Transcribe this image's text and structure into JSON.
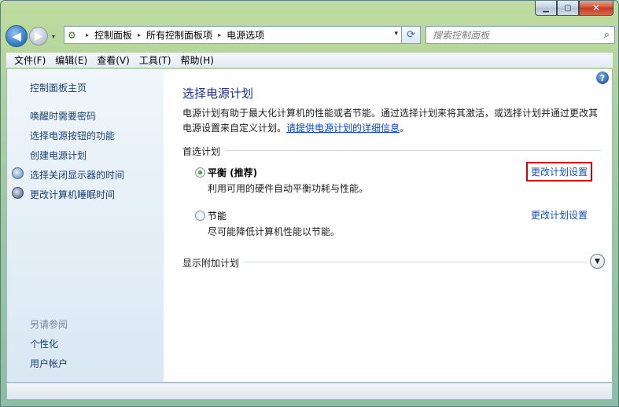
{
  "window": {
    "caption_min": "▁",
    "caption_max": "▢",
    "caption_close": "✕"
  },
  "nav": {
    "back_glyph": "◀",
    "forward_glyph": "▶",
    "dropdown_glyph": "▾"
  },
  "address": {
    "crumbs": [
      "控制面板",
      "所有控制面板项",
      "电源选项"
    ],
    "separator": "▸"
  },
  "search": {
    "placeholder": "搜索控制面板"
  },
  "menubar": {
    "items": [
      "文件(F)",
      "编辑(E)",
      "查看(V)",
      "工具(T)",
      "帮助(H)"
    ]
  },
  "sidebar": {
    "home": "控制面板主页",
    "links": [
      "唤醒时需要密码",
      "选择电源按钮的功能",
      "创建电源计划",
      "选择关闭显示器的时间",
      "更改计算机睡眠时间"
    ],
    "see_also_caption": "另请参阅",
    "see_also": [
      "个性化",
      "用户帐户"
    ]
  },
  "main": {
    "title": "选择电源计划",
    "description_part1": "电源计划有助于最大化计算机的性能或者节能。通过选择计划来将其激活，或选择计划并通过更改其电源设置来自定义计划。",
    "description_link": "请提供电源计划的详细信息",
    "description_end": "。",
    "preferred_header": "首选计划",
    "plans": [
      {
        "name": "平衡 (推荐)",
        "description": "利用可用的硬件自动平衡功耗与性能。",
        "change": "更改计划设置",
        "selected": true
      },
      {
        "name": "节能",
        "description": "尽可能降低计算机性能以节能。",
        "change": "更改计划设置",
        "selected": false
      }
    ],
    "additional_header": "显示附加计划",
    "help_glyph": "?"
  },
  "colors": {
    "title_blue": "#1e3287",
    "link_blue": "#1451b8",
    "highlight_red": "#e00000"
  }
}
